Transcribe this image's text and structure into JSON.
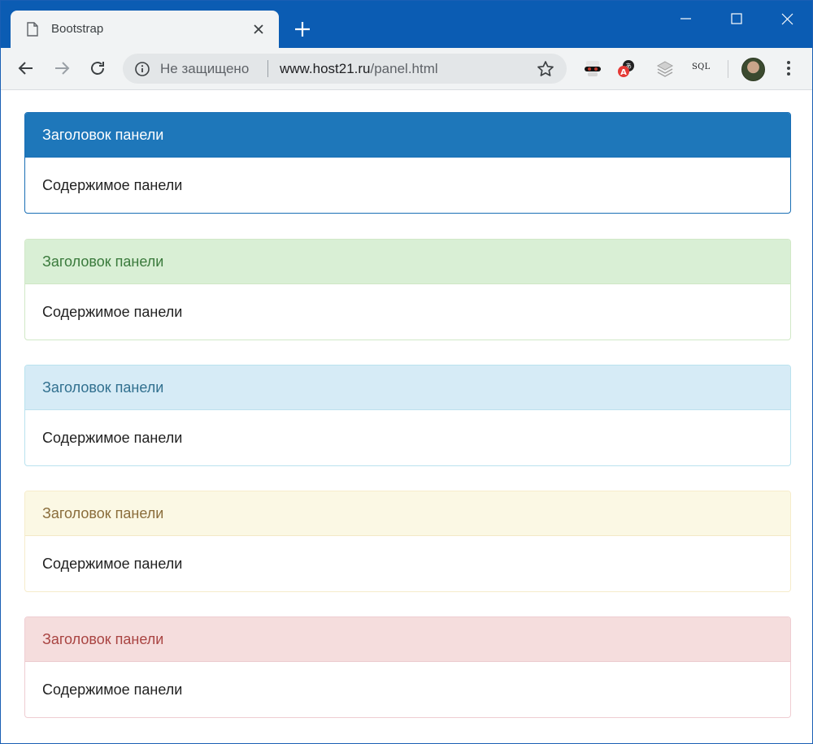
{
  "browser": {
    "tab_title": "Bootstrap",
    "security_label": "Не защищено",
    "url_host": "www.host21.ru",
    "url_path": "/panel.html",
    "ext_sql_label": "SQL"
  },
  "panels": [
    {
      "variant": "primary",
      "heading": "Заголовок панели",
      "body": "Содержимое панели",
      "heading_bg": "#1e77ba"
    },
    {
      "variant": "success",
      "heading": "Заголовок панели",
      "body": "Содержимое панели",
      "heading_bg": "#d9efd5"
    },
    {
      "variant": "info",
      "heading": "Заголовок панели",
      "body": "Содержимое панели",
      "heading_bg": "#d6ebf6"
    },
    {
      "variant": "warning",
      "heading": "Заголовок панели",
      "body": "Содержимое панели",
      "heading_bg": "#fbf8e4"
    },
    {
      "variant": "danger",
      "heading": "Заголовок панели",
      "body": "Содержимое панели",
      "heading_bg": "#f5dddd"
    }
  ],
  "colors": {
    "titlebar": "#0b5cb3",
    "toolbar": "#f1f3f4"
  },
  "icons": [
    "page-icon",
    "close-icon",
    "plus-icon",
    "minimize-icon",
    "maximize-icon",
    "window-close-icon",
    "back-arrow-icon",
    "forward-arrow-icon",
    "reload-icon",
    "info-icon",
    "star-icon",
    "spy-extension-icon",
    "translate-extension-icon",
    "layers-extension-icon",
    "menu-dots-icon"
  ]
}
